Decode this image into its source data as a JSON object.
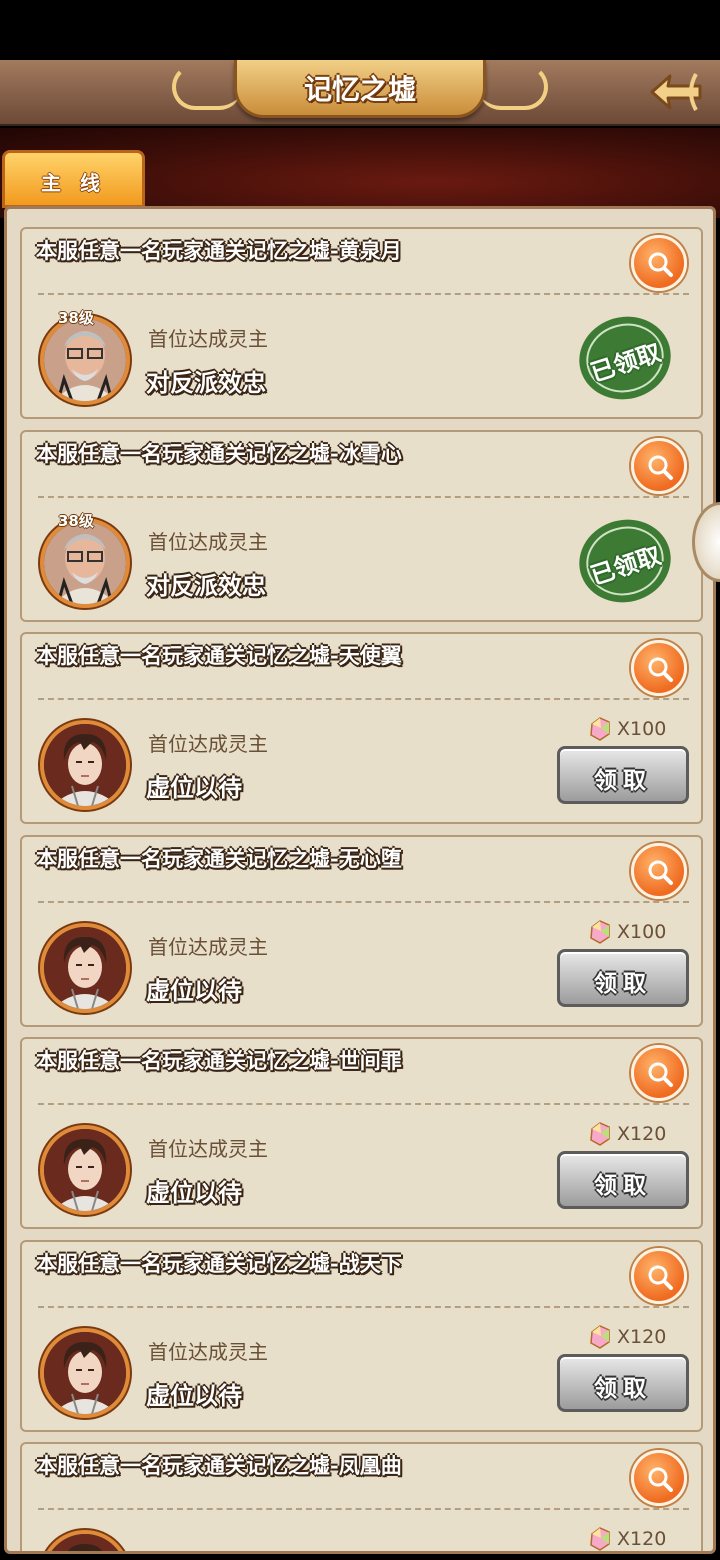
{
  "header": {
    "title": "记忆之墟"
  },
  "tabs": [
    {
      "label": "主 线",
      "active": true
    }
  ],
  "cards": [
    {
      "title": "本服任意一名玩家通关记忆之墟-黄泉月",
      "level": "38级",
      "subtitle": "首位达成灵主",
      "holder": "对反派效忠",
      "status": "claimed",
      "stamp": "已领取",
      "avatar": "old-man-glasses"
    },
    {
      "title": "本服任意一名玩家通关记忆之墟-冰雪心",
      "level": "38级",
      "subtitle": "首位达成灵主",
      "holder": "对反派效忠",
      "status": "claimed",
      "stamp": "已领取",
      "avatar": "old-man-glasses"
    },
    {
      "title": "本服任意一名玩家通关记忆之墟-天使翼",
      "subtitle": "首位达成灵主",
      "holder": "虚位以待",
      "status": "claimable",
      "reward": "X100",
      "button": "领取",
      "avatar": "young-man"
    },
    {
      "title": "本服任意一名玩家通关记忆之墟-无心堕",
      "subtitle": "首位达成灵主",
      "holder": "虚位以待",
      "status": "claimable",
      "reward": "X100",
      "button": "领取",
      "avatar": "young-man"
    },
    {
      "title": "本服任意一名玩家通关记忆之墟-世间罪",
      "subtitle": "首位达成灵主",
      "holder": "虚位以待",
      "status": "claimable",
      "reward": "X120",
      "button": "领取",
      "avatar": "young-man"
    },
    {
      "title": "本服任意一名玩家通关记忆之墟-战天下",
      "subtitle": "首位达成灵主",
      "holder": "虚位以待",
      "status": "claimable",
      "reward": "X120",
      "button": "领取",
      "avatar": "young-man"
    },
    {
      "title": "本服任意一名玩家通关记忆之墟-凤凰曲",
      "status": "claimable",
      "reward": "X120",
      "avatar": "young-man"
    }
  ],
  "colors": {
    "accent": "#ef6b20",
    "panel": "#e3d9c4",
    "stamp": "#2f6a2a",
    "tab": "#f29a1e"
  }
}
